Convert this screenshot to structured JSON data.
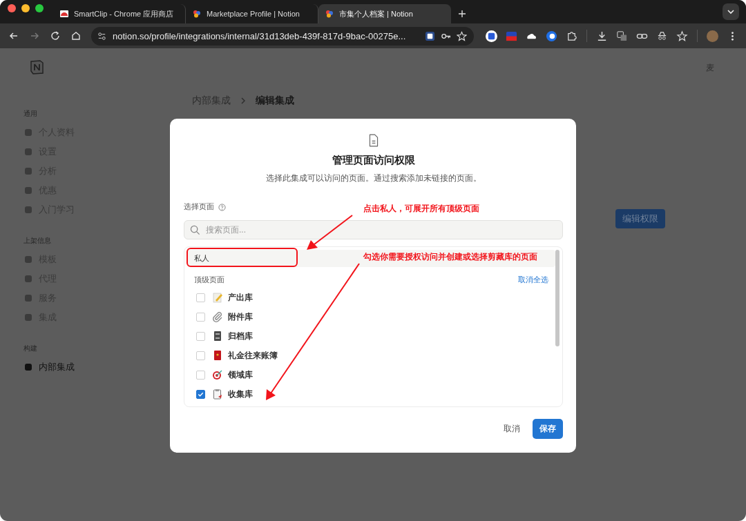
{
  "browser": {
    "tabs": [
      {
        "title": "SmartClip - Chrome 应用商店",
        "selected": false
      },
      {
        "title": "Marketplace Profile | Notion",
        "selected": false
      },
      {
        "title": "市集个人档案 | Notion",
        "selected": true
      }
    ],
    "url": "notion.so/profile/integrations/internal/31d13deb-439f-817d-9bac-00275e..."
  },
  "user_initial": "麦",
  "sidebar": {
    "sections": [
      {
        "label": "通用",
        "items": [
          {
            "label": "个人资料",
            "selected": false
          },
          {
            "label": "设置",
            "selected": false
          },
          {
            "label": "分析",
            "selected": false
          },
          {
            "label": "优惠",
            "selected": false
          },
          {
            "label": "入门学习",
            "selected": false
          }
        ]
      },
      {
        "label": "上架信息",
        "items": [
          {
            "label": "模板",
            "selected": false
          },
          {
            "label": "代理",
            "selected": false
          },
          {
            "label": "服务",
            "selected": false
          },
          {
            "label": "集成",
            "selected": false
          }
        ]
      },
      {
        "label": "构建",
        "items": [
          {
            "label": "内部集成",
            "selected": true
          }
        ]
      }
    ]
  },
  "breadcrumb": [
    "内部集成",
    "编辑集成"
  ],
  "edit_button": "编辑权限",
  "dialog": {
    "title": "管理页面访问权限",
    "subtitle": "选择此集成可以访问的页面。通过搜索添加未链接的页面。",
    "select_label": "选择页面",
    "search": {
      "placeholder": "搜索页面..."
    },
    "workspace": {
      "label": "私人",
      "hovered": true
    },
    "group": {
      "label": "顶级页面",
      "action": "取消全选"
    },
    "pages": [
      {
        "label": "产出库",
        "checked": false
      },
      {
        "label": "附件库",
        "checked": false
      },
      {
        "label": "归档库",
        "checked": false
      },
      {
        "label": "礼金往来账簿",
        "checked": false
      },
      {
        "label": "领域库",
        "checked": false
      },
      {
        "label": "收集库",
        "checked": true
      }
    ],
    "cancel": "取消",
    "save": "保存"
  },
  "annotations": [
    {
      "text": "点击私人，可展开所有顶级页面"
    },
    {
      "text": "勾选你需要授权访问并创建或选择剪藏库的页面"
    }
  ]
}
